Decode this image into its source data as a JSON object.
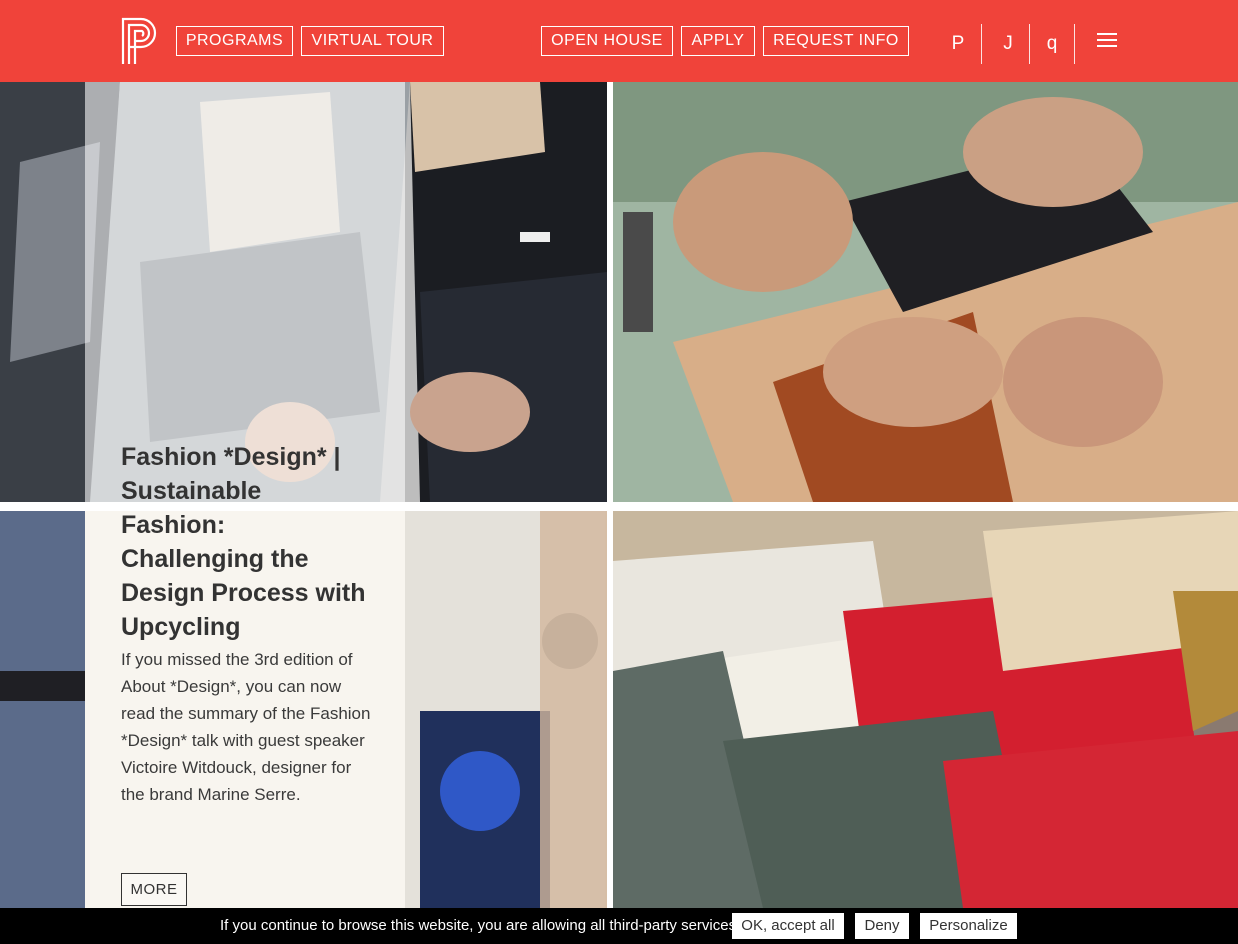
{
  "header": {
    "logo_icon": "pp-logo-icon",
    "nav_left": [
      {
        "label": "PROGRAMS"
      },
      {
        "label": "VIRTUAL TOUR"
      }
    ],
    "nav_right": [
      {
        "label": "OPEN HOUSE"
      },
      {
        "label": "APPLY"
      },
      {
        "label": "REQUEST INFO"
      }
    ],
    "icons": [
      {
        "glyph": "P"
      },
      {
        "glyph": "J"
      },
      {
        "glyph": "q"
      }
    ],
    "menu_icon": "hamburger-menu-icon",
    "brand_color": "#f0433a"
  },
  "article": {
    "title": "Fashion *Design* | Sustainable Fashion: Challenging the Design Process with Upcycling",
    "body": "If you missed the 3rd edition of About *Design*, you can now read the summary of the Fashion *Design* talk with guest speaker Victoire Witdouck, designer for the brand Marine Serre.",
    "more_label": "MORE"
  },
  "cookie_bar": {
    "text": "If you continue to browse this website, you are allowing all third-party services",
    "accept_label": "OK, accept all",
    "deny_label": "Deny",
    "personalize_label": "Personalize"
  }
}
